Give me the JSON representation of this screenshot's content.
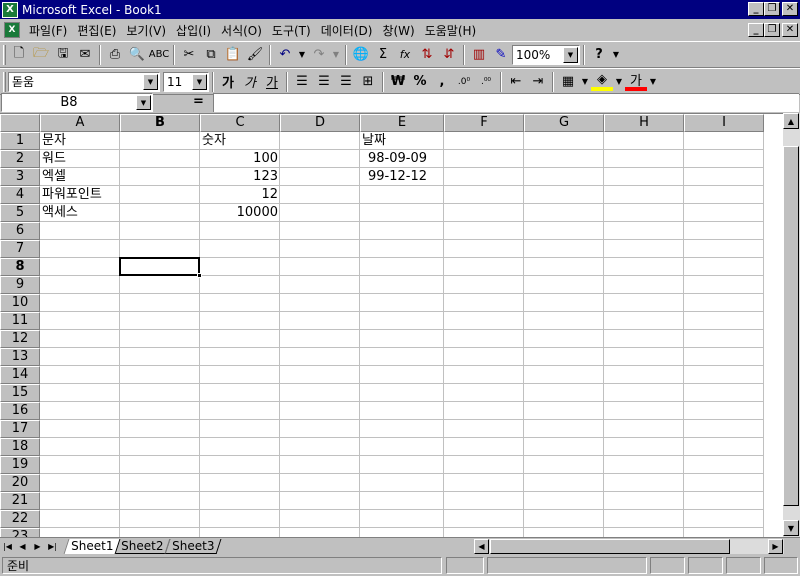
{
  "window": {
    "title": "Microsoft Excel - Book1",
    "app_icon": "X"
  },
  "menu": [
    "파일(F)",
    "편집(E)",
    "보기(V)",
    "삽입(I)",
    "서식(O)",
    "도구(T)",
    "데이터(D)",
    "창(W)",
    "도움말(H)"
  ],
  "toolbar": {
    "zoom": "100%",
    "font_name": "돋움",
    "font_size": "11",
    "bold_label": "가",
    "italic_label": "가",
    "underline_label": "가",
    "currency_label": "₩",
    "percent_label": "%",
    "comma_label": ",",
    "font_color_label": "가",
    "sum_label": "Σ",
    "function_label": "fx"
  },
  "formula_bar": {
    "name_box": "B8",
    "equals": "=",
    "content": ""
  },
  "sheet": {
    "columns": [
      "A",
      "B",
      "C",
      "D",
      "E",
      "F",
      "G",
      "H",
      "I"
    ],
    "rows": [
      "1",
      "2",
      "3",
      "4",
      "5",
      "6",
      "7",
      "8",
      "9",
      "10",
      "11",
      "12",
      "13",
      "14",
      "15",
      "16",
      "17",
      "18",
      "19",
      "20",
      "21",
      "22",
      "23"
    ],
    "active_cell": "B8",
    "cells": {
      "A1": "문자",
      "C1": "숫자",
      "E1": "날짜",
      "A2": "워드",
      "C2": "100",
      "E2": "98-09-09",
      "A3": "엑셀",
      "C3": "123",
      "E3": "99-12-12",
      "A4": "파워포인트",
      "C4": "12",
      "A5": "액세스",
      "C5": "10000"
    }
  },
  "tabs": [
    "Sheet1",
    "Sheet2",
    "Sheet3"
  ],
  "active_tab": "Sheet1",
  "status": {
    "text": "준비"
  }
}
